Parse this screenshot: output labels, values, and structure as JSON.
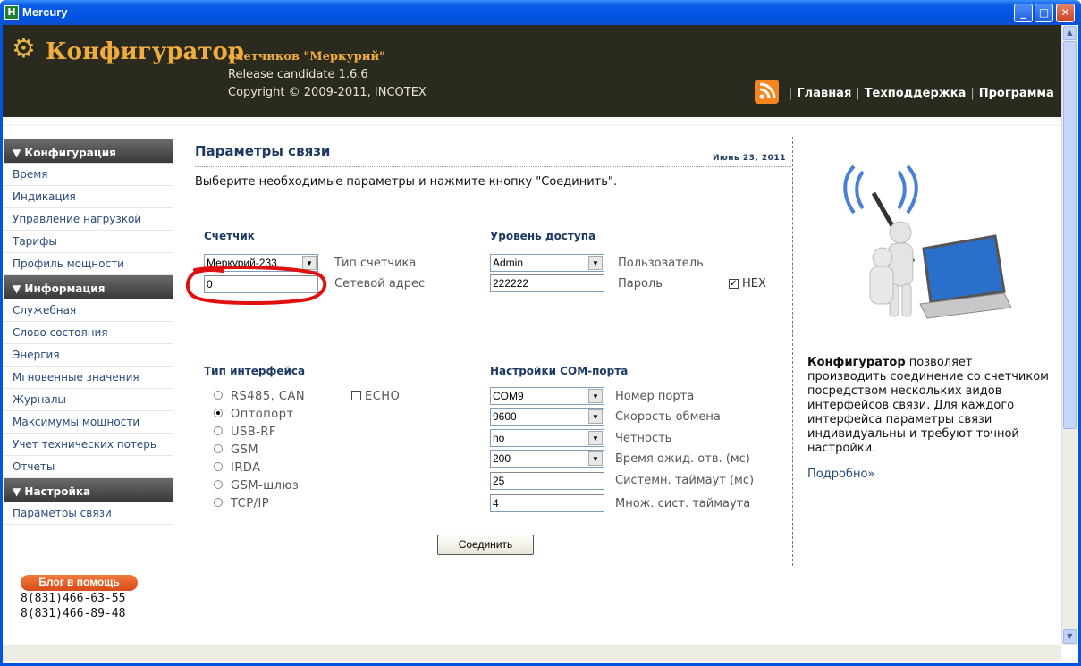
{
  "window": {
    "title": "Mercury",
    "icon_letter": "H",
    "buttons": [
      "_",
      "□",
      "✕"
    ]
  },
  "header": {
    "brand": "Конфигуратор",
    "brand_sub": "счетчиков \"Меркурий\"",
    "release": "Release candidate 1.6.6",
    "copyright": "Copyright © 2009-2011, INCOTEX",
    "nav": [
      "Главная",
      "Техподдержка",
      "Программа"
    ],
    "sep": "|"
  },
  "sidebar": {
    "sections": [
      {
        "title": "▼ Конфигурация",
        "items": [
          "Время",
          "Индикация",
          "Управление нагрузкой",
          "Тарифы",
          "Профиль мощности"
        ]
      },
      {
        "title": "▼ Информация",
        "items": [
          "Служебная",
          "Слово состояния",
          "Энергия",
          "Мгновенные значения",
          "Журналы",
          "Максимумы мощности",
          "Учет технических потерь",
          "Отчеты"
        ]
      },
      {
        "title": "▼ Настройка",
        "items": [
          "Параметры связи"
        ]
      }
    ],
    "blog": "Блог в помощь",
    "phones": [
      "8(831)466-63-55",
      "8(831)466-89-48"
    ]
  },
  "main": {
    "title": "Параметры связи",
    "date": "Июнь 23, 2011",
    "instruction": "Выберите необходимые параметры и нажмите кнопку \"Соединить\".",
    "meter": {
      "title": "Счетчик",
      "type_value": "Меркурий-233",
      "type_label": "Тип счетчика",
      "address_value": "0",
      "address_label": "Сетевой адрес"
    },
    "access": {
      "title": "Уровень доступа",
      "level_value": "Admin",
      "level_label": "Пользователь",
      "password_value": "222222",
      "password_label": "Пароль",
      "hex_label": "HEX",
      "hex_checked": true
    },
    "interface": {
      "title": "Тип интерфейса",
      "options": [
        "RS485, CAN",
        "Оптопорт",
        "USB-RF",
        "GSM",
        "IRDA",
        "GSM-шлюз",
        "TCP/IP"
      ],
      "selected": "Оптопорт",
      "echo_label": "ECHO",
      "echo_checked": false
    },
    "com": {
      "title": "Настройки COM-порта",
      "port_value": "COM9",
      "port_label": "Номер порта",
      "baud_value": "9600",
      "baud_label": "Скорость обмена",
      "parity_value": "no",
      "parity_label": "Четность",
      "wait_value": "200",
      "wait_label": "Время ожид. отв. (мс)",
      "sys_timeout_value": "25",
      "sys_timeout_label": "Системн. таймаут (мс)",
      "mult_value": "4",
      "mult_label": "Множ. сист. таймаута"
    },
    "connect_button": "Соединить"
  },
  "aside": {
    "desc_bold": "Конфигуратор",
    "desc_rest": " позволяет производить соединение со счетчиком посредством нескольких видов интерфейсов связи. Для каждого интерфейса параметры связи индивидуальны и требуют точной настройки.",
    "more": "Подробно»"
  },
  "colors": {
    "header_bg": "#2b2a1f",
    "brand": "#f0ad3e",
    "title": "#1d3a63",
    "link": "#2a4a7a",
    "annotation": "#e01010"
  }
}
